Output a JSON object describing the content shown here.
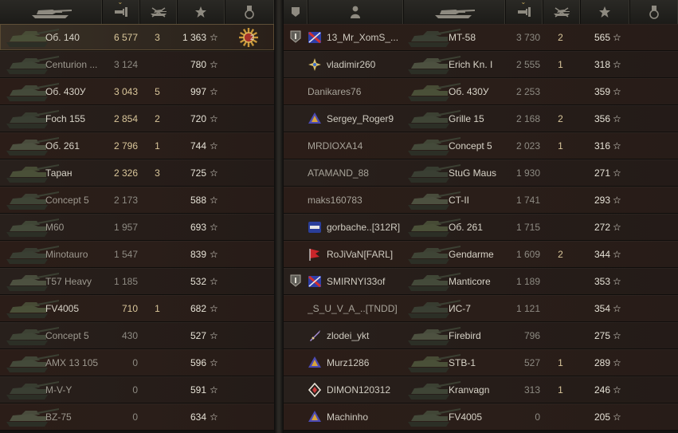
{
  "left_team": [
    {
      "tank": "Об. 140",
      "damage": "6 577",
      "kills": "3",
      "exp": "1 363",
      "self": true,
      "medal": "2",
      "dim": false
    },
    {
      "tank": "Centurion ...",
      "damage": "3 124",
      "kills": "",
      "exp": "780",
      "dim": true
    },
    {
      "tank": "Об. 430У",
      "damage": "3 043",
      "kills": "5",
      "exp": "997",
      "dim": false
    },
    {
      "tank": "Foch 155",
      "damage": "2 854",
      "kills": "2",
      "exp": "720",
      "dim": false
    },
    {
      "tank": "Об. 261",
      "damage": "2 796",
      "kills": "1",
      "exp": "744",
      "dim": false
    },
    {
      "tank": "Таран",
      "damage": "2 326",
      "kills": "3",
      "exp": "725",
      "dim": false
    },
    {
      "tank": "Concept 5",
      "damage": "2 173",
      "kills": "",
      "exp": "588",
      "dim": true
    },
    {
      "tank": "M60",
      "damage": "1 957",
      "kills": "",
      "exp": "693",
      "dim": true
    },
    {
      "tank": "Minotauro",
      "damage": "1 547",
      "kills": "",
      "exp": "839",
      "dim": true
    },
    {
      "tank": "T57 Heavy",
      "damage": "1 185",
      "kills": "",
      "exp": "532",
      "dim": true
    },
    {
      "tank": "FV4005",
      "damage": "710",
      "kills": "1",
      "exp": "682",
      "dim": false
    },
    {
      "tank": "Concept 5",
      "damage": "430",
      "kills": "",
      "exp": "527",
      "dim": true
    },
    {
      "tank": "AMX 13 105",
      "damage": "0",
      "kills": "",
      "exp": "596",
      "dim": true
    },
    {
      "tank": "M-V-Y",
      "damage": "0",
      "kills": "",
      "exp": "591",
      "dim": true
    },
    {
      "tank": "BZ-75",
      "damage": "0",
      "kills": "",
      "exp": "634",
      "dim": true
    }
  ],
  "right_team": [
    {
      "player": "13_Mr_XomS_...",
      "tank": "MT-58",
      "damage": "3 730",
      "kills": "2",
      "exp": "565",
      "platoon": true,
      "badge": "near",
      "dim": false
    },
    {
      "player": "vladimir260",
      "tank": "Erich Kn. I",
      "damage": "2 555",
      "kills": "1",
      "exp": "318",
      "badge": "star",
      "dim": false
    },
    {
      "player": "Danikares76",
      "tank": "Об. 430У",
      "damage": "2 253",
      "kills": "",
      "exp": "359",
      "dim": true
    },
    {
      "player": "Sergey_Roger9",
      "tank": "Grille 15",
      "damage": "2 168",
      "kills": "2",
      "exp": "356",
      "badge": "tri",
      "dim": false
    },
    {
      "player": "MRDIOXA14",
      "tank": "Concept 5",
      "damage": "2 023",
      "kills": "1",
      "exp": "316",
      "dim": true
    },
    {
      "player": "ATAMAND_88",
      "tank": "StuG Maus",
      "damage": "1 930",
      "kills": "",
      "exp": "271",
      "dim": true
    },
    {
      "player": "maks160783",
      "tank": "CT-II",
      "damage": "1 741",
      "kills": "",
      "exp": "293",
      "dim": true
    },
    {
      "player": "gorbache..[312R]",
      "tank": "Об. 261",
      "damage": "1 715",
      "kills": "",
      "exp": "272",
      "badge": "yusha",
      "dim": false
    },
    {
      "player": "RoJiVaN[FARL]",
      "tank": "Gendarme",
      "damage": "1 609",
      "kills": "2",
      "exp": "344",
      "badge": "flag",
      "dim": false
    },
    {
      "player": "SMIRNYI33of",
      "tank": "Manticore",
      "damage": "1 189",
      "kills": "",
      "exp": "353",
      "platoon": true,
      "badge": "near",
      "dim": false
    },
    {
      "player": "_S_U_V_A_..[TNDD]",
      "tank": "ИС-7",
      "damage": "1 121",
      "kills": "",
      "exp": "354",
      "dim": true
    },
    {
      "player": "zlodei_ykt",
      "tank": "Firebird",
      "damage": "796",
      "kills": "",
      "exp": "275",
      "badge": "sword",
      "dim": false
    },
    {
      "player": "Murz1286",
      "tank": "STB-1",
      "damage": "527",
      "kills": "1",
      "exp": "289",
      "badge": "tri",
      "dim": false
    },
    {
      "player": "DIMON120312",
      "tank": "Kranvagn",
      "damage": "313",
      "kills": "1",
      "exp": "246",
      "badge": "diamond",
      "dim": false
    },
    {
      "player": "Machinho",
      "tank": "FV4005",
      "damage": "0",
      "kills": "",
      "exp": "205",
      "badge": "tri",
      "dim": false
    }
  ],
  "colors": {
    "gold": "#d9c69a",
    "dim": "#8d8a82",
    "row": "#2a1e19",
    "accent": "#c7a85a"
  },
  "icons": [
    "tank-header-icon",
    "damage-icon",
    "kills-icon",
    "exp-star-icon",
    "medal-icon",
    "platoon-icon",
    "player-icon"
  ]
}
